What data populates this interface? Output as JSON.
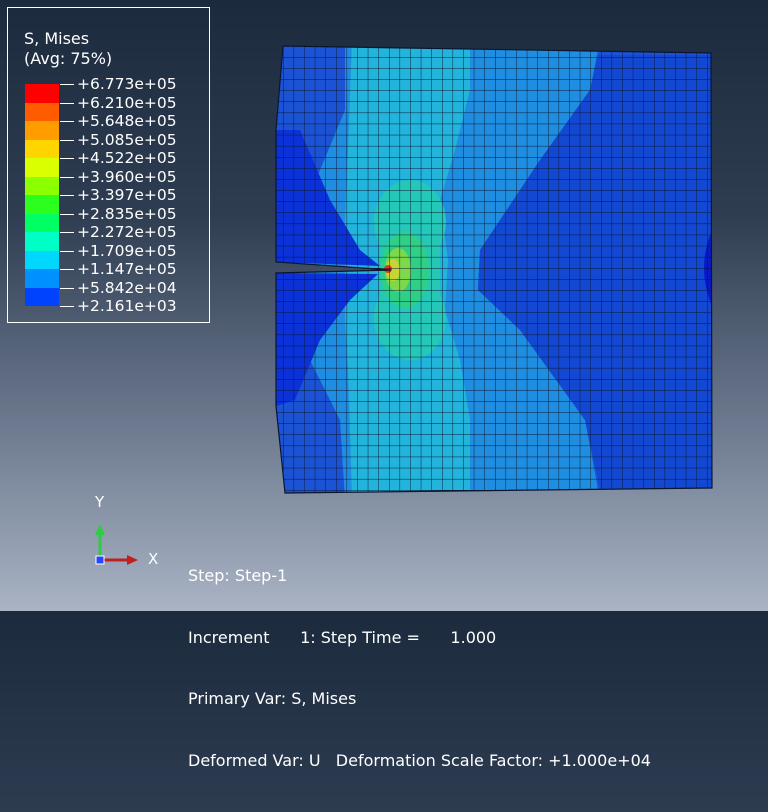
{
  "legend": {
    "title": "S, Mises",
    "subtitle": "(Avg: 75%)",
    "levels": [
      {
        "label": "+6.773e+05",
        "color": "#ff0000"
      },
      {
        "label": "+6.210e+05",
        "color": "#ff5c00"
      },
      {
        "label": "+5.648e+05",
        "color": "#ff9c00"
      },
      {
        "label": "+5.085e+05",
        "color": "#ffd500"
      },
      {
        "label": "+4.522e+05",
        "color": "#d9ff00"
      },
      {
        "label": "+3.960e+05",
        "color": "#8cff00"
      },
      {
        "label": "+3.397e+05",
        "color": "#2cff1e"
      },
      {
        "label": "+2.835e+05",
        "color": "#00ff62"
      },
      {
        "label": "+2.272e+05",
        "color": "#00ffc6"
      },
      {
        "label": "+1.709e+05",
        "color": "#00d7ff"
      },
      {
        "label": "+1.147e+05",
        "color": "#0090ff"
      },
      {
        "label": "+5.842e+04",
        "color": "#0043ff"
      },
      {
        "label": "+2.161e+03",
        "color": "#0000ff"
      }
    ]
  },
  "triad": {
    "x_label": "X",
    "y_label": "Y"
  },
  "info": {
    "line1": "Step: Step-1",
    "line2": "Increment      1: Step Time =      1.000",
    "line3": "Primary Var: S, Mises",
    "line4": "Deformed Var: U   Deformation Scale Factor: +1.000e+04"
  },
  "colors": {
    "mesh_line": "#0a1630",
    "dark_blue": "#0a2ed6",
    "blue": "#1c58d8",
    "light_blue": "#1f8ee0",
    "cyan": "#24b6d8",
    "teal": "#22c9bb",
    "green": "#2fcf87",
    "yellow": "#b6d63b",
    "red": "#e23a1a"
  }
}
